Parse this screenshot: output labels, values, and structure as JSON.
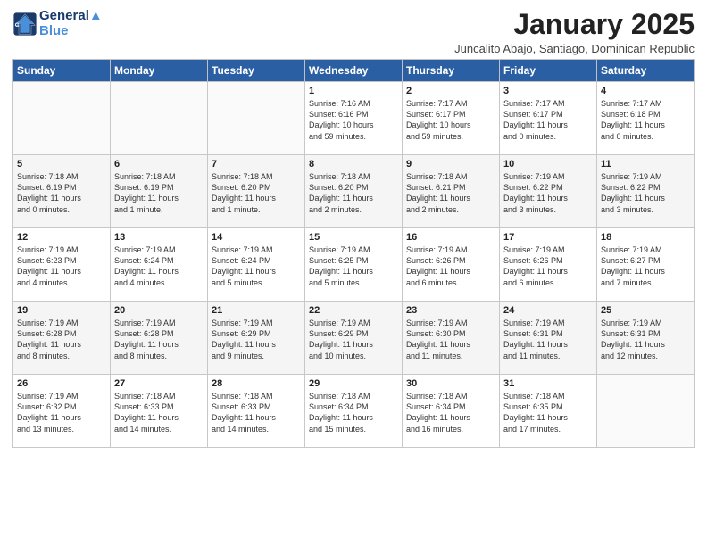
{
  "logo": {
    "line1": "General",
    "line2": "Blue"
  },
  "title": "January 2025",
  "subtitle": "Juncalito Abajo, Santiago, Dominican Republic",
  "days_of_week": [
    "Sunday",
    "Monday",
    "Tuesday",
    "Wednesday",
    "Thursday",
    "Friday",
    "Saturday"
  ],
  "weeks": [
    [
      {
        "day": "",
        "info": ""
      },
      {
        "day": "",
        "info": ""
      },
      {
        "day": "",
        "info": ""
      },
      {
        "day": "1",
        "info": "Sunrise: 7:16 AM\nSunset: 6:16 PM\nDaylight: 10 hours\nand 59 minutes."
      },
      {
        "day": "2",
        "info": "Sunrise: 7:17 AM\nSunset: 6:17 PM\nDaylight: 10 hours\nand 59 minutes."
      },
      {
        "day": "3",
        "info": "Sunrise: 7:17 AM\nSunset: 6:17 PM\nDaylight: 11 hours\nand 0 minutes."
      },
      {
        "day": "4",
        "info": "Sunrise: 7:17 AM\nSunset: 6:18 PM\nDaylight: 11 hours\nand 0 minutes."
      }
    ],
    [
      {
        "day": "5",
        "info": "Sunrise: 7:18 AM\nSunset: 6:19 PM\nDaylight: 11 hours\nand 0 minutes."
      },
      {
        "day": "6",
        "info": "Sunrise: 7:18 AM\nSunset: 6:19 PM\nDaylight: 11 hours\nand 1 minute."
      },
      {
        "day": "7",
        "info": "Sunrise: 7:18 AM\nSunset: 6:20 PM\nDaylight: 11 hours\nand 1 minute."
      },
      {
        "day": "8",
        "info": "Sunrise: 7:18 AM\nSunset: 6:20 PM\nDaylight: 11 hours\nand 2 minutes."
      },
      {
        "day": "9",
        "info": "Sunrise: 7:18 AM\nSunset: 6:21 PM\nDaylight: 11 hours\nand 2 minutes."
      },
      {
        "day": "10",
        "info": "Sunrise: 7:19 AM\nSunset: 6:22 PM\nDaylight: 11 hours\nand 3 minutes."
      },
      {
        "day": "11",
        "info": "Sunrise: 7:19 AM\nSunset: 6:22 PM\nDaylight: 11 hours\nand 3 minutes."
      }
    ],
    [
      {
        "day": "12",
        "info": "Sunrise: 7:19 AM\nSunset: 6:23 PM\nDaylight: 11 hours\nand 4 minutes."
      },
      {
        "day": "13",
        "info": "Sunrise: 7:19 AM\nSunset: 6:24 PM\nDaylight: 11 hours\nand 4 minutes."
      },
      {
        "day": "14",
        "info": "Sunrise: 7:19 AM\nSunset: 6:24 PM\nDaylight: 11 hours\nand 5 minutes."
      },
      {
        "day": "15",
        "info": "Sunrise: 7:19 AM\nSunset: 6:25 PM\nDaylight: 11 hours\nand 5 minutes."
      },
      {
        "day": "16",
        "info": "Sunrise: 7:19 AM\nSunset: 6:26 PM\nDaylight: 11 hours\nand 6 minutes."
      },
      {
        "day": "17",
        "info": "Sunrise: 7:19 AM\nSunset: 6:26 PM\nDaylight: 11 hours\nand 6 minutes."
      },
      {
        "day": "18",
        "info": "Sunrise: 7:19 AM\nSunset: 6:27 PM\nDaylight: 11 hours\nand 7 minutes."
      }
    ],
    [
      {
        "day": "19",
        "info": "Sunrise: 7:19 AM\nSunset: 6:28 PM\nDaylight: 11 hours\nand 8 minutes."
      },
      {
        "day": "20",
        "info": "Sunrise: 7:19 AM\nSunset: 6:28 PM\nDaylight: 11 hours\nand 8 minutes."
      },
      {
        "day": "21",
        "info": "Sunrise: 7:19 AM\nSunset: 6:29 PM\nDaylight: 11 hours\nand 9 minutes."
      },
      {
        "day": "22",
        "info": "Sunrise: 7:19 AM\nSunset: 6:29 PM\nDaylight: 11 hours\nand 10 minutes."
      },
      {
        "day": "23",
        "info": "Sunrise: 7:19 AM\nSunset: 6:30 PM\nDaylight: 11 hours\nand 11 minutes."
      },
      {
        "day": "24",
        "info": "Sunrise: 7:19 AM\nSunset: 6:31 PM\nDaylight: 11 hours\nand 11 minutes."
      },
      {
        "day": "25",
        "info": "Sunrise: 7:19 AM\nSunset: 6:31 PM\nDaylight: 11 hours\nand 12 minutes."
      }
    ],
    [
      {
        "day": "26",
        "info": "Sunrise: 7:19 AM\nSunset: 6:32 PM\nDaylight: 11 hours\nand 13 minutes."
      },
      {
        "day": "27",
        "info": "Sunrise: 7:18 AM\nSunset: 6:33 PM\nDaylight: 11 hours\nand 14 minutes."
      },
      {
        "day": "28",
        "info": "Sunrise: 7:18 AM\nSunset: 6:33 PM\nDaylight: 11 hours\nand 14 minutes."
      },
      {
        "day": "29",
        "info": "Sunrise: 7:18 AM\nSunset: 6:34 PM\nDaylight: 11 hours\nand 15 minutes."
      },
      {
        "day": "30",
        "info": "Sunrise: 7:18 AM\nSunset: 6:34 PM\nDaylight: 11 hours\nand 16 minutes."
      },
      {
        "day": "31",
        "info": "Sunrise: 7:18 AM\nSunset: 6:35 PM\nDaylight: 11 hours\nand 17 minutes."
      },
      {
        "day": "",
        "info": ""
      }
    ]
  ]
}
